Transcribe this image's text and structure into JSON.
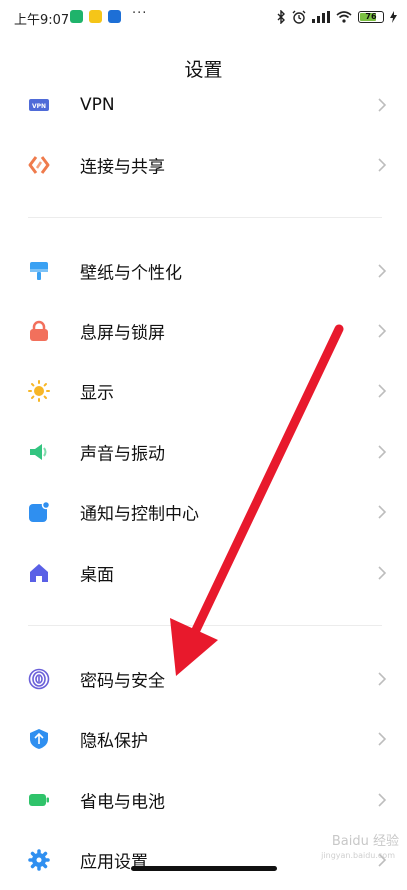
{
  "status_bar": {
    "time": "上午9:07",
    "dots": "···",
    "battery_level": "76",
    "battery_fraction": 0.76
  },
  "page": {
    "title": "设置"
  },
  "settings_items": [
    {
      "label": "VPN",
      "icon": "vpn-icon",
      "color": "#4f6bd8"
    },
    {
      "label": "连接与共享",
      "icon": "connection-share-icon",
      "color": "#ef7b4c"
    },
    {
      "label": "壁纸与个性化",
      "icon": "wallpaper-icon",
      "color": "#3aa1f3"
    },
    {
      "label": "息屏与锁屏",
      "icon": "lock-icon",
      "color": "#f2705c"
    },
    {
      "label": "显示",
      "icon": "display-sun-icon",
      "color": "#f7b626"
    },
    {
      "label": "声音与振动",
      "icon": "speaker-icon",
      "color": "#33c480"
    },
    {
      "label": "通知与控制中心",
      "icon": "notification-icon",
      "color": "#2f8ff0"
    },
    {
      "label": "桌面",
      "icon": "home-icon",
      "color": "#5a60e6"
    },
    {
      "label": "密码与安全",
      "icon": "fingerprint-icon",
      "color": "#6a5fd9"
    },
    {
      "label": "隐私保护",
      "icon": "privacy-shield-icon",
      "color": "#2f8ff0"
    },
    {
      "label": "省电与电池",
      "icon": "battery-icon",
      "color": "#2fc36a"
    },
    {
      "label": "应用设置",
      "icon": "app-settings-gear-icon",
      "color": "#2f8ff0"
    }
  ],
  "watermark": {
    "text": "Baidu 经验",
    "sub": "jingyan.baidu.com"
  }
}
